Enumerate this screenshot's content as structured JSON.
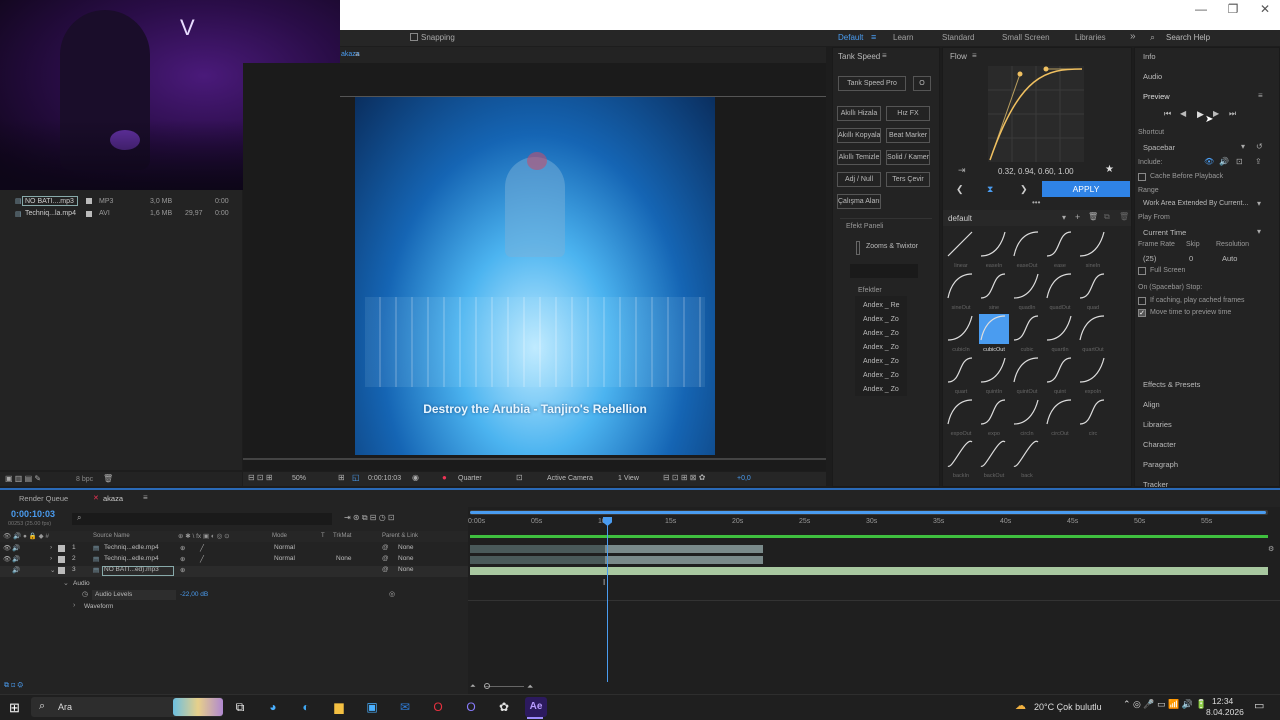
{
  "window": {
    "minimize": "—",
    "restore": "❐",
    "close": "✕"
  },
  "topbar": {
    "snapping": "Snapping"
  },
  "workspaces": [
    {
      "label": "Default",
      "active": true
    },
    {
      "label": "Learn"
    },
    {
      "label": "Standard"
    },
    {
      "label": "Small Screen"
    },
    {
      "label": "Libraries"
    }
  ],
  "search_help": "Search Help",
  "comp_tab": "akaza",
  "project": {
    "files": [
      {
        "name": "NO BATI....mp3",
        "type": "MP3",
        "size": "3,0 MB",
        "fps": "",
        "dur": "0:00"
      },
      {
        "name": "Techniq...la.mp4",
        "type": "AVI",
        "size": "1,6 MB",
        "fps": "29,97",
        "dur": "0:00"
      }
    ]
  },
  "viewer": {
    "subtitle": "Destroy the Arubia - Tanjiro's Rebellion",
    "zoom": "50%",
    "timecode": "0:00:10:03",
    "resolution": "Quarter",
    "camera": "Active Camera",
    "views": "1 View",
    "exposure": "+0,0",
    "bpc": "8 bpc"
  },
  "tank_speed": {
    "title": "Tank Speed",
    "pro_btn": "Tank Speed Pro",
    "o_btn": "O",
    "buttons": [
      [
        "Akıllı Hizala",
        "Hız FX"
      ],
      [
        "Akıllı Kopyala",
        "Beat Marker"
      ],
      [
        "Akıllı Temizle",
        "Solid / Kamera"
      ],
      [
        "Adj / Null",
        "Ters Çevir"
      ]
    ],
    "single": "Çalışma Alanı",
    "effects_panel": "Efekt Paneli",
    "zooms": "Zooms & Twixtor",
    "effects_label": "Efektler",
    "effects_list": [
      "Andex _ Re",
      "Andex _ Zo",
      "Andex _ Zo",
      "Andex _ Zo",
      "Andex _ Zo",
      "Andex _ Zo",
      "Andex _ Zo"
    ]
  },
  "flow": {
    "title": "Flow",
    "values": "0.32, 0.94, 0.60, 1.00",
    "apply": "APPLY",
    "preset": "default",
    "curves": [
      "linear",
      "easeIn",
      "easeOut",
      "ease",
      "sineIn",
      "sineOut",
      "sine",
      "quadIn",
      "quadOut",
      "quad",
      "cubicIn",
      "cubicOut",
      "cubic",
      "quartIn",
      "quartOut",
      "quart",
      "quintIn",
      "quintOut",
      "quint",
      "expoIn",
      "expoOut",
      "expo",
      "circIn",
      "circOut",
      "circ",
      "backIn",
      "backOut",
      "back"
    ],
    "selected": "cubicOut"
  },
  "preview": {
    "info": "Info",
    "audio": "Audio",
    "title": "Preview",
    "shortcut_label": "Shortcut",
    "shortcut": "Spacebar",
    "include": "Include:",
    "cache": "Cache Before Playback",
    "range_label": "Range",
    "range": "Work Area Extended By Current...",
    "play_from_label": "Play From",
    "play_from": "Current Time",
    "frame_rate_label": "Frame Rate",
    "skip_label": "Skip",
    "resolution_label": "Resolution",
    "frame_rate": "(25)",
    "skip": "0",
    "resolution": "Auto",
    "full_screen": "Full Screen",
    "stop_label": "On (Spacebar) Stop:",
    "if_caching": "If caching, play cached frames",
    "move_time": "Move time to preview time",
    "sections": [
      "Effects & Presets",
      "Align",
      "Libraries",
      "Character",
      "Paragraph",
      "Tracker"
    ]
  },
  "timeline": {
    "render_queue": "Render Queue",
    "comp": "akaza",
    "timecode": "0:00:10:03",
    "frames": "00253 (25.00 fps)",
    "col_source": "Source Name",
    "col_mode": "Mode",
    "col_t": "T",
    "col_trkmat": "TrkMat",
    "col_parent": "Parent & Link",
    "layers": [
      {
        "num": "1",
        "name": "Techniq...edle.mp4",
        "mode": "Normal",
        "trkmat": "",
        "parent": "None"
      },
      {
        "num": "2",
        "name": "Techniq...edle.mp4",
        "mode": "Normal",
        "trkmat": "None",
        "parent": "None"
      },
      {
        "num": "3",
        "name": "NO BATI...ed).mp3",
        "mode": "",
        "trkmat": "",
        "parent": "None"
      }
    ],
    "audio": "Audio",
    "audio_levels": "Audio Levels",
    "audio_value": "-22,00 dB",
    "waveform": "Waveform",
    "ruler": [
      "0:00s",
      "05s",
      "10s",
      "15s",
      "20s",
      "25s",
      "30s",
      "35s",
      "40s",
      "45s",
      "50s",
      "55s"
    ]
  },
  "taskbar": {
    "search": "Ara",
    "weather": "20°C  Çok bulutlu",
    "time": "12:34",
    "date": "8.04.2026"
  }
}
